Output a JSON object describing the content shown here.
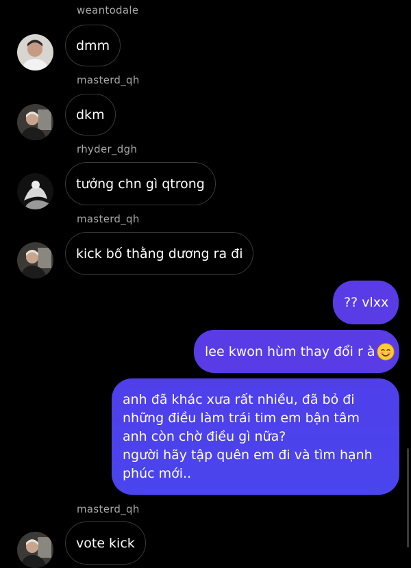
{
  "chat": {
    "messages": [
      {
        "sender": "weantodale",
        "text": "dmm"
      },
      {
        "sender": "masterd_qh",
        "text": "dkm"
      },
      {
        "sender": "rhyder_dgh",
        "text": "tưởng chn gì qtrong"
      },
      {
        "sender": "masterd_qh",
        "text": "kick bố thằng dương ra đi"
      },
      {
        "sender": "me",
        "text": "?? vlxx"
      },
      {
        "sender": "me",
        "text": "lee kwon hùm thay đổi r à",
        "emoji": "smiling-face-icon"
      },
      {
        "sender": "me",
        "lines": [
          "anh đã khác xưa rất nhiều, đã bỏ đi",
          "những điều làm trái tim em bận tâm",
          "anh còn chờ điều gì nữa?",
          "người hãy tập quên em đi và tìm hạnh",
          "phúc mới.."
        ]
      },
      {
        "sender": "masterd_qh",
        "text": "vote kick"
      }
    ]
  },
  "colors": {
    "background": "#000000",
    "incoming_border": "#3a3a3c",
    "outgoing_bubble": "#5a3ce6",
    "username_text": "#a8a8a8"
  }
}
